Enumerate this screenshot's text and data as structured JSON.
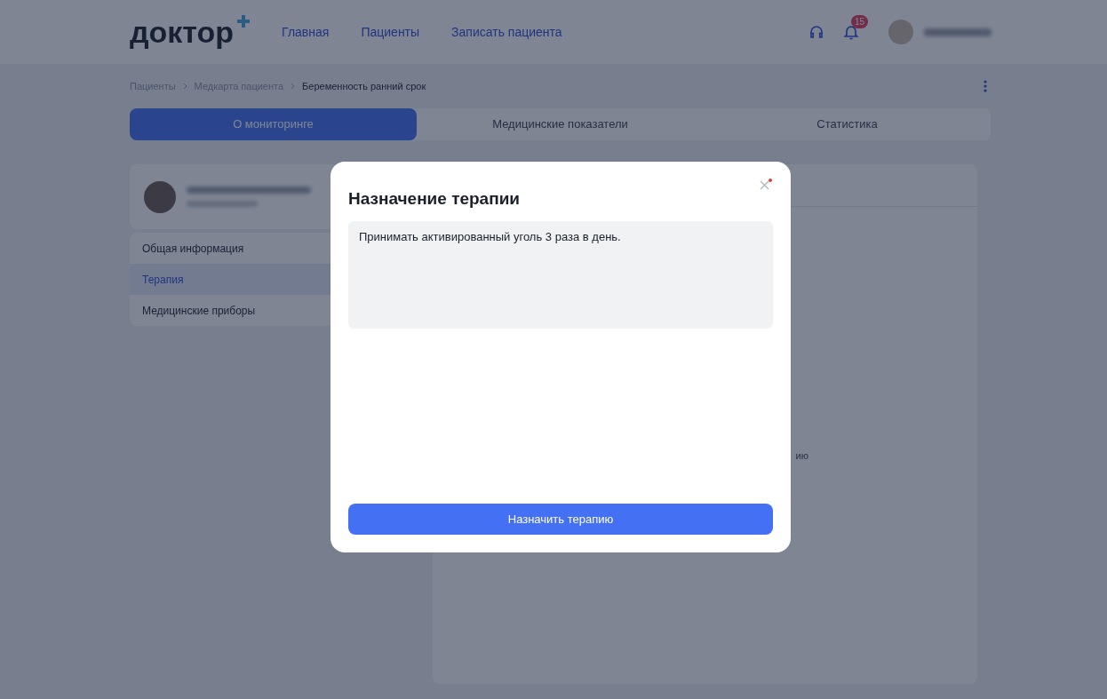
{
  "header": {
    "logo": "доктор",
    "nav": [
      {
        "label": "Главная",
        "selected": false
      },
      {
        "label": "Пациенты",
        "selected": false
      },
      {
        "label": "Записать пациента",
        "selected": false
      }
    ],
    "notification_count": "15"
  },
  "breadcrumbs": [
    "Пациенты",
    "Медкарта пациента",
    "Беременность ранний срок"
  ],
  "tabs": [
    {
      "label": "О мониторинге",
      "selected": true
    },
    {
      "label": "Медицинские показатели",
      "selected": false
    },
    {
      "label": "Статистика",
      "selected": false
    }
  ],
  "sidebar": {
    "items": [
      {
        "label": "Общая информация",
        "selected": false
      },
      {
        "label": "Терапия",
        "selected": true
      },
      {
        "label": "Медицинские приборы",
        "selected": false
      }
    ]
  },
  "main": {
    "text_fragment": "ию"
  },
  "modal": {
    "title": "Назначение терапии",
    "textarea_value": "Принимать активированный уголь 3 раза в день.",
    "button": "Назначить терапию"
  }
}
